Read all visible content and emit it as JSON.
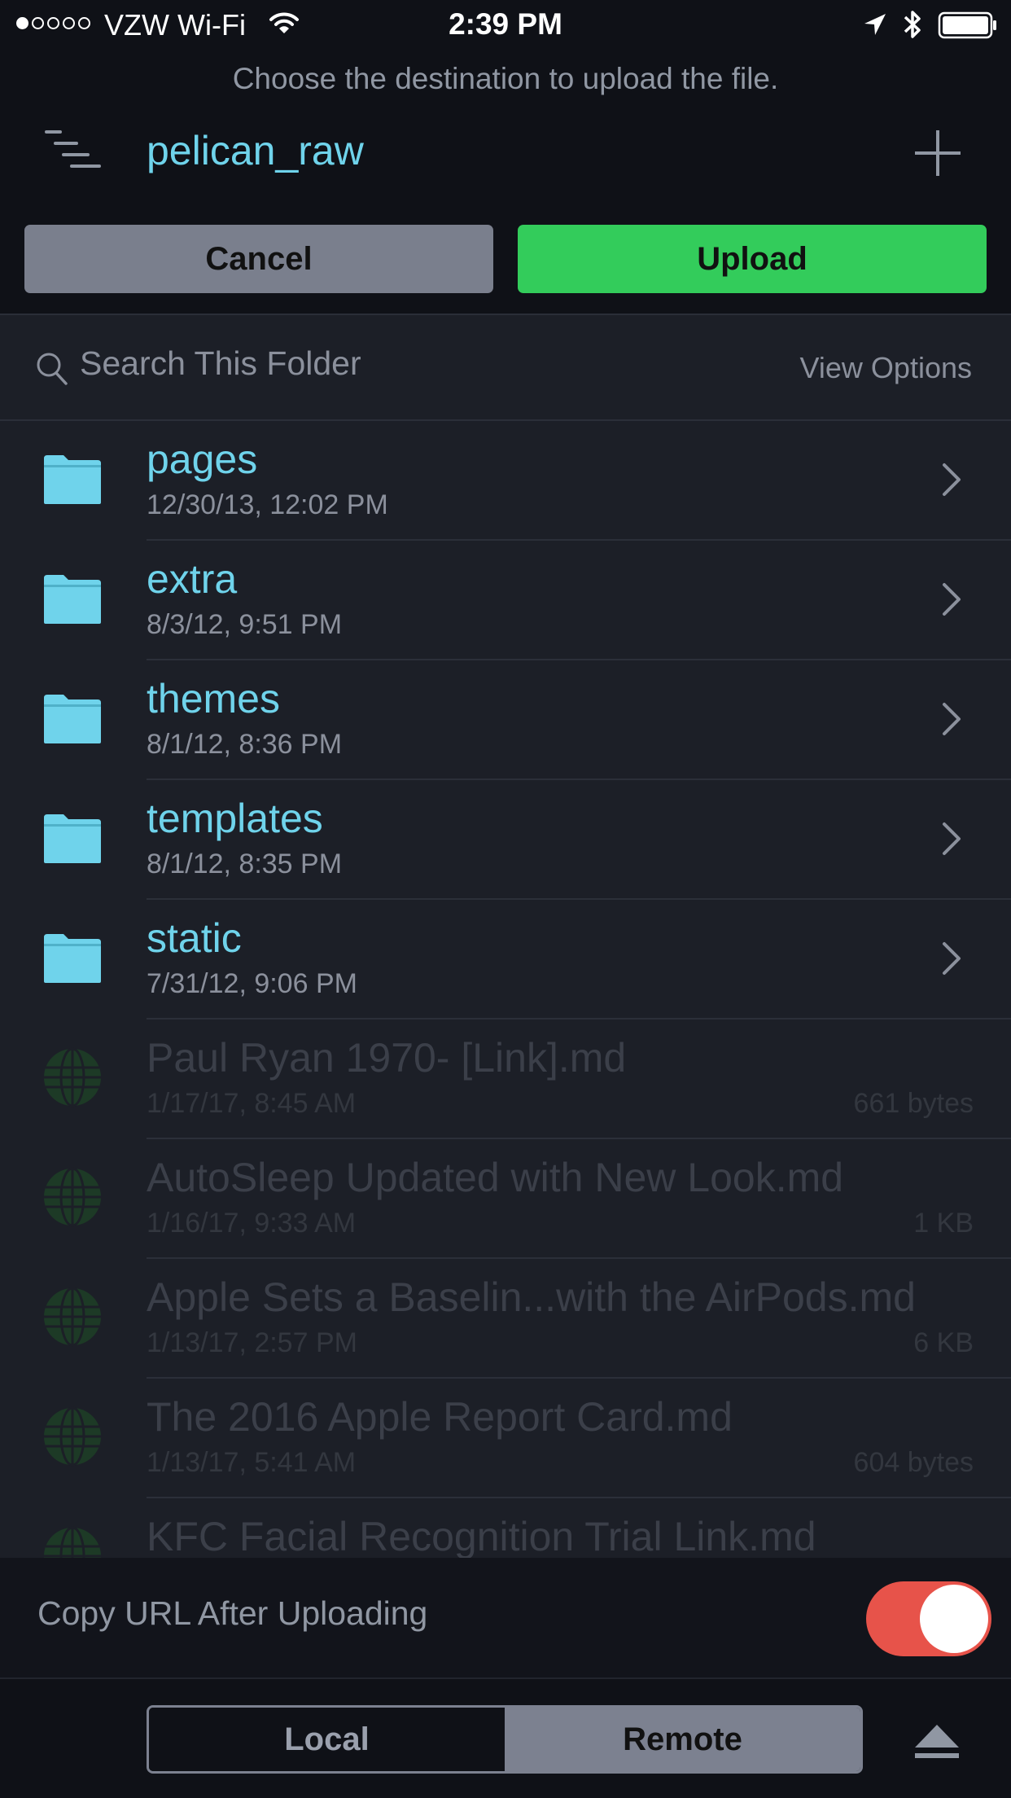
{
  "status_bar": {
    "carrier": "VZW Wi-Fi",
    "time": "2:39 PM"
  },
  "header": {
    "instruction": "Choose the destination to upload the file.",
    "folder_title": "pelican_raw",
    "cancel_label": "Cancel",
    "upload_label": "Upload"
  },
  "search": {
    "placeholder": "Search This Folder",
    "view_options_label": "View Options"
  },
  "items": [
    {
      "name": "pages",
      "date": "12/30/13, 12:02 PM",
      "type": "folder"
    },
    {
      "name": "extra",
      "date": "8/3/12, 9:51 PM",
      "type": "folder"
    },
    {
      "name": "themes",
      "date": "8/1/12, 8:36 PM",
      "type": "folder"
    },
    {
      "name": "templates",
      "date": "8/1/12, 8:35 PM",
      "type": "folder"
    },
    {
      "name": "static",
      "date": "7/31/12, 9:06 PM",
      "type": "folder"
    },
    {
      "name": "Paul Ryan 1970- [Link].md",
      "date": "1/17/17, 8:45 AM",
      "size": "661 bytes",
      "type": "file"
    },
    {
      "name": "AutoSleep Updated with New Look.md",
      "date": "1/16/17, 9:33 AM",
      "size": "1 KB",
      "type": "file"
    },
    {
      "name": "Apple Sets a Baselin...with the AirPods.md",
      "date": "1/13/17, 2:57 PM",
      "size": "6 KB",
      "type": "file"
    },
    {
      "name": "The 2016 Apple Report Card.md",
      "date": "1/13/17, 5:41 AM",
      "size": "604 bytes",
      "type": "file"
    },
    {
      "name": "KFC Facial Recognition Trial Link.md",
      "date": "",
      "size": "",
      "type": "file"
    }
  ],
  "copy_url": {
    "label": "Copy URL After Uploading",
    "enabled": true
  },
  "tabs": {
    "local_label": "Local",
    "remote_label": "Remote",
    "selected": "Remote"
  },
  "colors": {
    "accent_cyan": "#6fd3eb",
    "upload_green": "#33cc5b",
    "toggle_red": "#e7534a",
    "background": "#1c1f27"
  },
  "icons": {
    "folder": "folder-icon",
    "file": "globe-icon",
    "chevron": "chevron-right-icon"
  }
}
